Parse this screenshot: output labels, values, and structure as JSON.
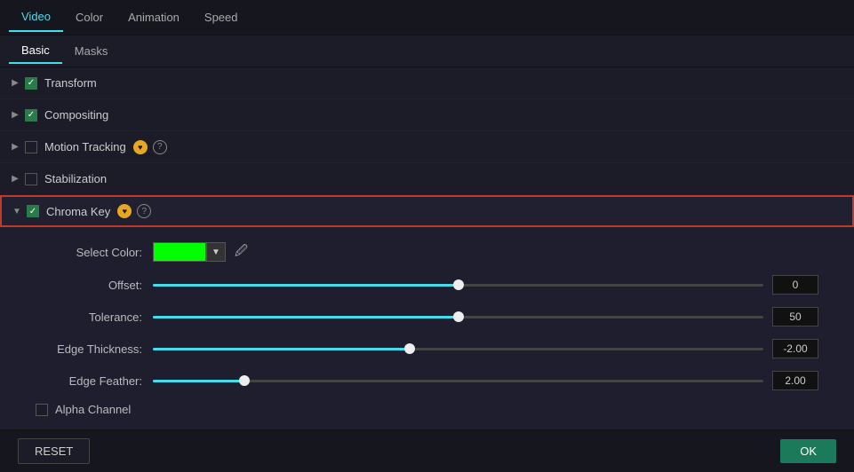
{
  "tabs": {
    "top": [
      {
        "id": "video",
        "label": "Video",
        "active": true
      },
      {
        "id": "color",
        "label": "Color",
        "active": false
      },
      {
        "id": "animation",
        "label": "Animation",
        "active": false
      },
      {
        "id": "speed",
        "label": "Speed",
        "active": false
      }
    ],
    "sub": [
      {
        "id": "basic",
        "label": "Basic",
        "active": true
      },
      {
        "id": "masks",
        "label": "Masks",
        "active": false
      }
    ]
  },
  "panels": [
    {
      "id": "transform",
      "label": "Transform",
      "checked": true,
      "expanded": false,
      "hasBadge": false,
      "hasQuestion": false
    },
    {
      "id": "compositing",
      "label": "Compositing",
      "checked": true,
      "expanded": false,
      "hasBadge": false,
      "hasQuestion": false
    },
    {
      "id": "motion-tracking",
      "label": "Motion Tracking",
      "checked": false,
      "expanded": false,
      "hasBadge": true,
      "hasQuestion": true
    },
    {
      "id": "stabilization",
      "label": "Stabilization",
      "checked": false,
      "expanded": false,
      "hasBadge": false,
      "hasQuestion": false
    },
    {
      "id": "chroma-key",
      "label": "Chroma Key",
      "checked": true,
      "expanded": true,
      "hasBadge": true,
      "hasQuestion": true
    }
  ],
  "chroma_key": {
    "select_color_label": "Select Color:",
    "offset_label": "Offset:",
    "offset_value": "0",
    "offset_pct": 50,
    "tolerance_label": "Tolerance:",
    "tolerance_value": "50",
    "tolerance_pct": 50,
    "edge_thickness_label": "Edge Thickness:",
    "edge_thickness_value": "-2.00",
    "edge_thickness_pct": 42,
    "edge_feather_label": "Edge Feather:",
    "edge_feather_value": "2.00",
    "edge_feather_pct": 15,
    "alpha_channel_label": "Alpha Channel"
  },
  "buttons": {
    "reset": "RESET",
    "ok": "OK"
  }
}
